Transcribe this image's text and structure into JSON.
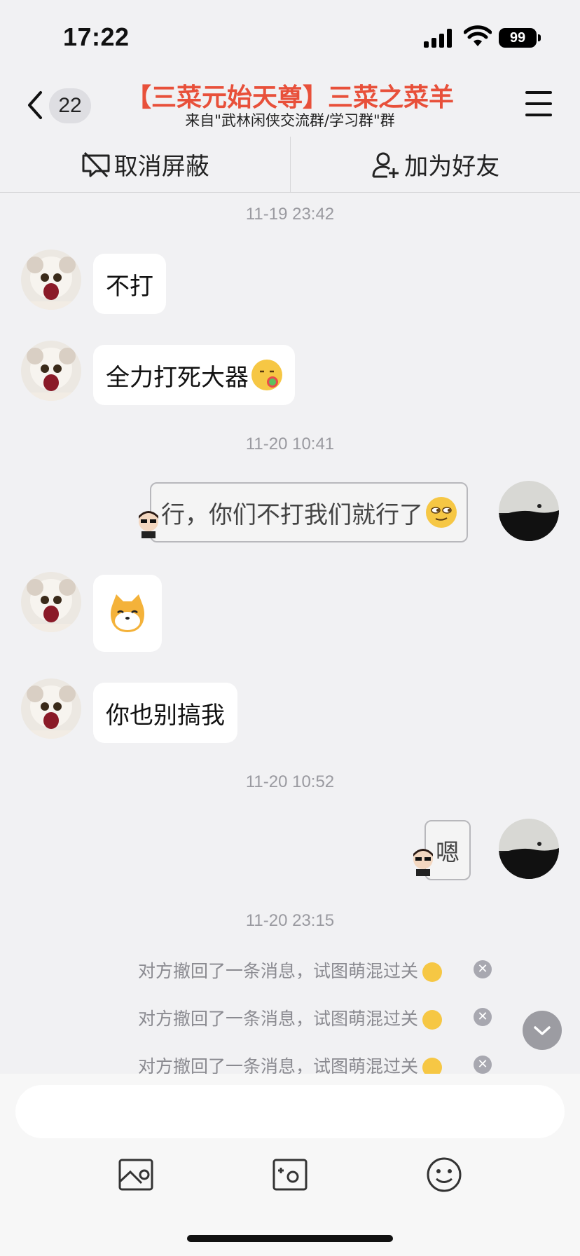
{
  "status_bar": {
    "time": "17:22",
    "battery": "99"
  },
  "nav": {
    "back_count": "22",
    "title": "【三菜元始天尊】三菜之菜羊",
    "subtitle": "来自\"武林闲侠交流群/学习群\"群"
  },
  "actions": {
    "unblock": "取消屏蔽",
    "add_friend": "加为好友"
  },
  "timestamps": [
    "11-19 23:42",
    "11-20 10:41",
    "11-20 10:52",
    "11-20 23:15"
  ],
  "messages": {
    "m1": "不打",
    "m2": "全力打死大器",
    "m3": "行，你们不打我们就行了",
    "m5": "你也别搞我",
    "m6": "嗯"
  },
  "recall_notice": "对方撤回了一条消息，试图萌混过关",
  "colors": {
    "title": "#e8503a",
    "background": "#f1f1f3"
  },
  "icons": [
    "back-chevron-icon",
    "menu-icon",
    "unblock-icon",
    "add-friend-icon",
    "image-icon",
    "photo-icon",
    "emoji-icon",
    "scroll-down-icon"
  ]
}
